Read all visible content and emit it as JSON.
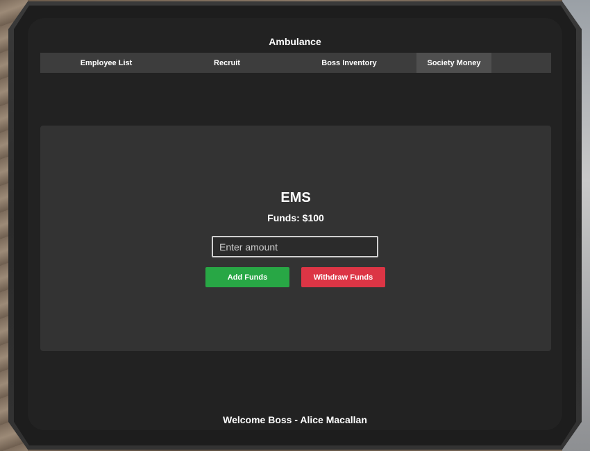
{
  "header": {
    "title": "Ambulance"
  },
  "tabs": [
    {
      "label": "Employee List"
    },
    {
      "label": "Recruit"
    },
    {
      "label": "Boss Inventory"
    },
    {
      "label": "Society Money",
      "active": true
    }
  ],
  "society": {
    "name": "EMS",
    "funds_text": "Funds: $100",
    "amount_input": {
      "value": "",
      "placeholder": "Enter amount"
    },
    "add_label": "Add Funds",
    "withdraw_label": "Withdraw Funds"
  },
  "footer": {
    "welcome": "Welcome Boss - Alice Macallan"
  },
  "colors": {
    "screen_bg": "#222222",
    "panel_bg": "#333333",
    "tab_bar_bg": "#3d3d3d",
    "active_tab_bg": "#4f4f4f",
    "add_button": "#28a745",
    "withdraw_button": "#dc3545"
  }
}
